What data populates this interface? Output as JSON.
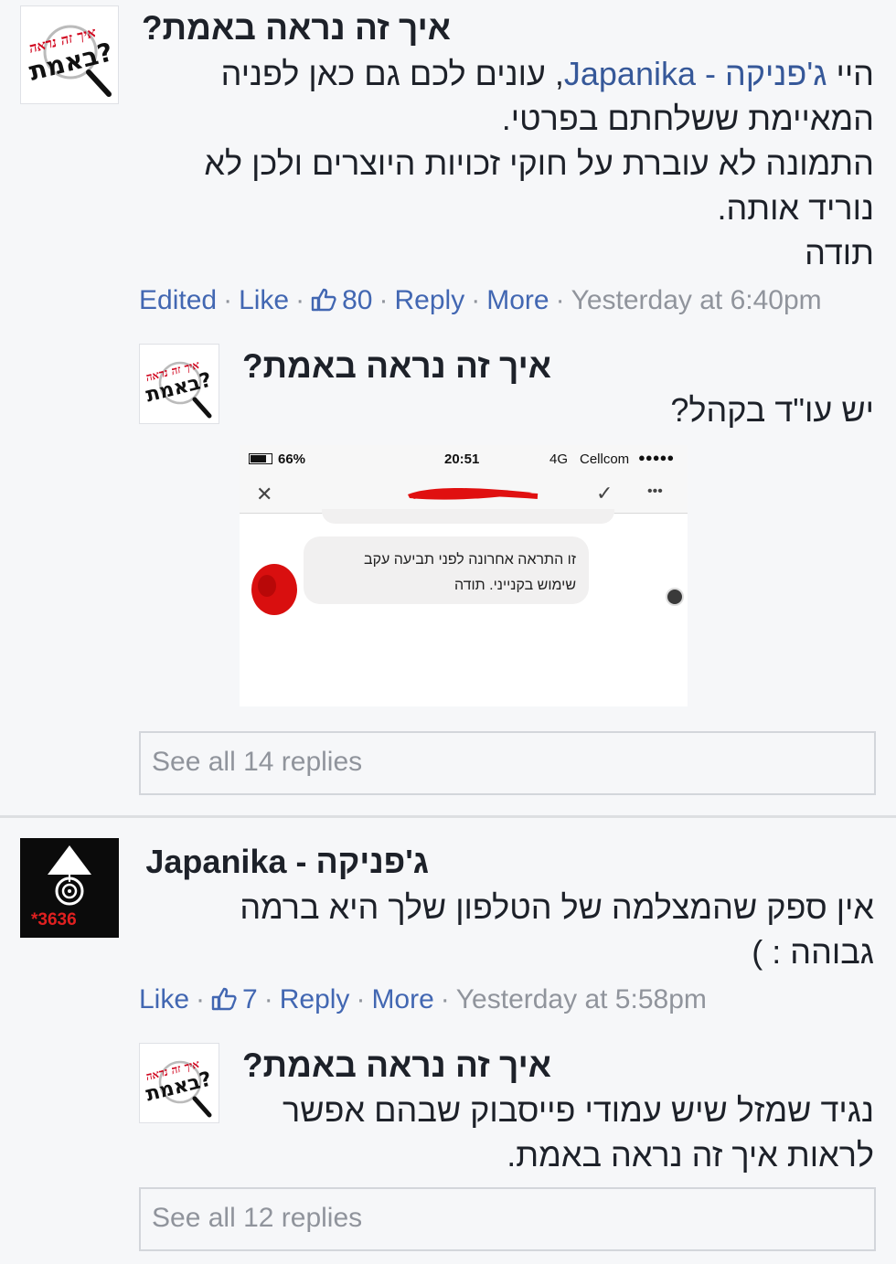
{
  "comments": [
    {
      "author": "איך זה נראה באמת?",
      "avatar_logo": {
        "line1": "איך זה נראה",
        "line2": "באמת?"
      },
      "text_parts": {
        "greeting": "היי ",
        "mention": "ג'פניקה - Japanika",
        "line1_rest": ", עונים לכם גם כאן לפניה",
        "line2": "המאיימת ששלחתם בפרטי.",
        "line3": "התמונה לא עוברת על חוקי זכויות היוצרים ולכן לא",
        "line4": "נוריד אותה.",
        "line5": "תודה"
      },
      "meta": {
        "edited": "Edited",
        "like": "Like",
        "like_count": "80",
        "reply": "Reply",
        "more": "More",
        "time": "Yesterday at 6:40pm"
      },
      "reply": {
        "author": "איך זה נראה באמת?",
        "text": "יש עו\"ד בקהל?",
        "screenshot": {
          "battery": "66%",
          "clock": "20:51",
          "network": "4G",
          "carrier": "Cellcom",
          "signal": "●●●●●",
          "close_glyph": "✕",
          "check_glyph": "✓",
          "dots_glyph": "•••",
          "bubble_line1": "זו התראה אחרונה לפני תביעה עקב",
          "bubble_line2": "שימוש בקנייני. תודה"
        }
      },
      "see_all": "See all 14 replies"
    },
    {
      "author": "ג'פניקה - Japanika",
      "avatar_badge": "3636",
      "text_line1": "אין ספק שהמצלמה של הטלפון שלך היא ברמה",
      "text_line2": "גבוהה : )",
      "meta": {
        "like": "Like",
        "like_count": "7",
        "reply": "Reply",
        "more": "More",
        "time": "Yesterday at 5:58pm"
      },
      "reply": {
        "author": "איך זה נראה באמת?",
        "text_line1": "נגיד שמזל שיש עמודי פייסבוק שבהם אפשר",
        "text_line2": "לראות איך זה נראה באמת."
      },
      "see_all": "See all 12 replies"
    }
  ],
  "colors": {
    "link": "#365899",
    "meta_action": "#4267b2",
    "meta_gray": "#90949c",
    "red_scribble": "#e01010",
    "logo_red": "#d0021b"
  },
  "icons": {
    "like": "thumbs-up-icon",
    "close": "close-icon",
    "check": "check-icon",
    "more": "more-dots-icon"
  }
}
